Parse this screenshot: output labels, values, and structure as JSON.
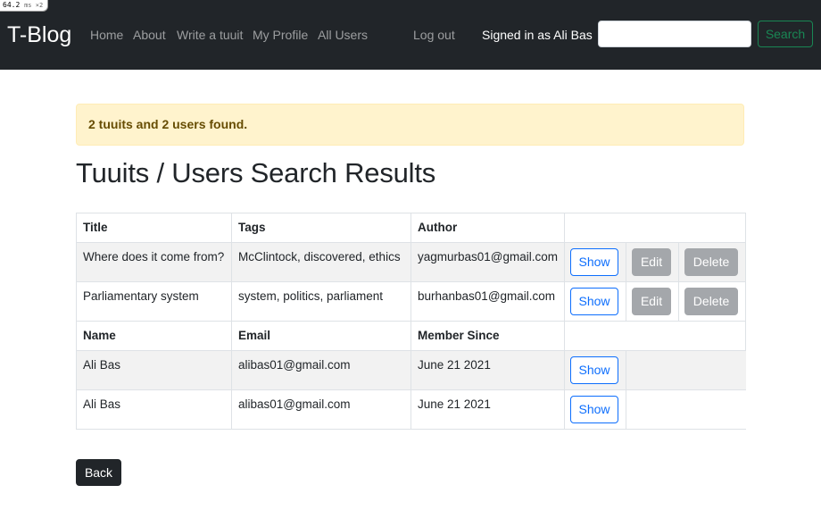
{
  "perf_badge": {
    "value": "64.2",
    "unit": "ms ×2"
  },
  "navbar": {
    "brand": "T-Blog",
    "links": [
      "Home",
      "About",
      "Write a tuuit",
      "My Profile",
      "All Users",
      "Log out"
    ],
    "signed_in": "Signed in as Ali Bas",
    "search_value": "",
    "search_button": "Search"
  },
  "alert": {
    "text": "2 tuuits and 2 users found."
  },
  "page_title": "Tuuits / Users Search Results",
  "tuuits_table": {
    "headers": [
      "Title",
      "Tags",
      "Author"
    ],
    "rows": [
      {
        "title": "Where does it come from?",
        "tags": "McClintock, discovered, ethics",
        "author": "yagmurbas01@gmail.com"
      },
      {
        "title": "Parliamentary system",
        "tags": "system, politics, parliament",
        "author": "burhanbas01@gmail.com"
      }
    ],
    "show_label": "Show",
    "edit_label": "Edit",
    "delete_label": "Delete"
  },
  "users_table": {
    "headers": [
      "Name",
      "Email",
      "Member Since"
    ],
    "rows": [
      {
        "name": "Ali Bas",
        "email": "alibas01@gmail.com",
        "member_since": "June 21 2021"
      },
      {
        "name": "Ali Bas",
        "email": "alibas01@gmail.com",
        "member_since": "June 21 2021"
      }
    ],
    "show_label": "Show"
  },
  "back_button": "Back"
}
